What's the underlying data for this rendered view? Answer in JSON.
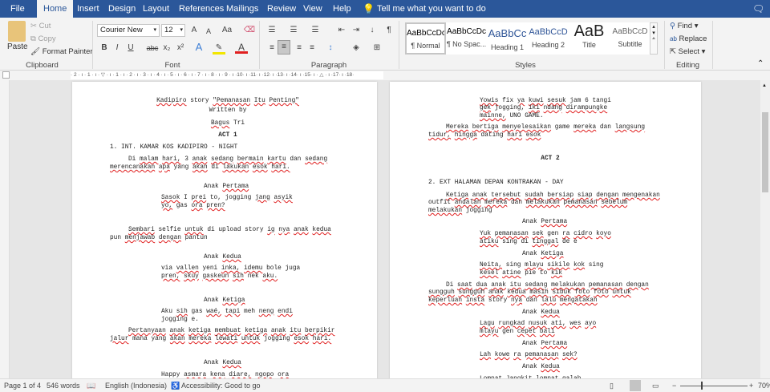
{
  "tabs": [
    "File",
    "Home",
    "Insert",
    "Design",
    "Layout",
    "References",
    "Mailings",
    "Review",
    "View",
    "Help"
  ],
  "tell_me": "Tell me what you want to do",
  "clipboard": {
    "paste": "Paste",
    "cut": "Cut",
    "copy": "Copy",
    "format_painter": "Format Painter",
    "label": "Clipboard"
  },
  "font": {
    "name": "Courier New",
    "size": "12",
    "label": "Font",
    "bold": "B",
    "italic": "I",
    "underline": "U",
    "strike": "abc",
    "sub": "x₂",
    "sup": "x²",
    "case": "Aa",
    "grow": "A",
    "shrink": "A",
    "color_letter": "A"
  },
  "paragraph": {
    "label": "Paragraph"
  },
  "styles": {
    "label": "Styles",
    "items": [
      {
        "preview": "AaBbCcDc",
        "name": "¶ Normal"
      },
      {
        "preview": "AaBbCcDc",
        "name": "¶ No Spac..."
      },
      {
        "preview": "AaBbCc",
        "name": "Heading 1"
      },
      {
        "preview": "AaBbCcD",
        "name": "Heading 2"
      },
      {
        "preview": "AaB",
        "name": "Title"
      },
      {
        "preview": "AaBbCcD",
        "name": "Subtitle"
      }
    ]
  },
  "editing": {
    "find": "Find",
    "replace": "Replace",
    "select": "Select",
    "label": "Editing"
  },
  "ruler": {
    "ticks": "· 2 · ı · 1 · ı · ▽ · ı · 1 · ı · 2 · ı · 3 · ı · 4 · ı · 5 · ı · 6 · ı · 7 · ı · 8 · ı · 9 · ı ·10· ı ·11· ı ·12· ı ·13· ı ·14· ı ·15· ı · △ · ı ·17· ı ·18·"
  },
  "spellcheck_flagged": [
    "Kadipiro",
    "\"Pemanasan",
    "Itu",
    "Penting\"",
    "Bagus",
    "malam",
    "hari,",
    "anak",
    "sedang",
    "bermain",
    "kartu",
    "merencanakan",
    "apa",
    "akan",
    "lakukan",
    "esok",
    "hari.",
    "Pertama",
    "Sasok",
    "prei",
    "jang",
    "asyik",
    "yo,",
    "ora",
    "pren?",
    "Sembari",
    "untuk",
    "ig",
    "nya",
    "kedua",
    "menjawab",
    "dengan",
    "Kedua",
    "vallen",
    "inka,",
    "idemu",
    "pren,",
    "skuy",
    "gaskeun",
    "sih",
    "aku.",
    "Ketiga",
    "waé,",
    "tapi",
    "neng",
    "endi",
    "Pertanyaan",
    "ketiga",
    "membuat",
    "itu",
    "berpikir",
    "jalur",
    "mereka",
    "lewati",
    "asmara",
    "kena",
    "diare,",
    "ngopo",
    "Yowis",
    "ya",
    "kuwi",
    "sesuk",
    "gek",
    "iki",
    "ndang",
    "dirampungke",
    "mainne,",
    "Mereka",
    "bertiga",
    "menyelesaikan",
    "langsung",
    "tidur,",
    "hingga",
    "hari",
    "esok",
    "Ketiga",
    "tersebut",
    "sudah",
    "bersiap",
    "siap",
    "mengenakan",
    "andalan",
    "melakukan",
    "pemanasan",
    "sebelum",
    "Yuk",
    "sek",
    "ra",
    "cidro",
    "koyo",
    "atiku",
    "tinggal",
    "Neita,",
    "mlayu",
    "sikile",
    "kok",
    "kesel",
    "atine",
    "kik",
    "saat",
    "dua",
    "sungguh",
    "masih",
    "sibuk",
    "foto",
    "keperluan",
    "insta",
    "lalu",
    "mengatakan",
    "Lagu",
    "rungkad",
    "nusuk",
    "ati,",
    "wes",
    "ayo",
    "cepet",
    "bali",
    "Lah",
    "kowe",
    "sek?",
    "Jangkit",
    "galah."
  ],
  "page1": [
    {
      "t": "Kadipiro story \"Pemanasan Itu Penting\"",
      "s": "c"
    },
    {
      "t": "Written by",
      "s": "c"
    },
    {
      "t": "Bagus Tri",
      "s": "c"
    },
    {
      "t": "ACT 1",
      "s": "cb"
    },
    {
      "t": "1. INT. KAMAR KOS KADIPIRO - NIGHT",
      "s": "l"
    },
    {
      "t": "Di malam hari, 3 anak sedang bermain kartu dan sedang",
      "s": "i"
    },
    {
      "t": "merencanakan apa yang akan di lakukan esok hari.",
      "s": "l"
    },
    {
      "t": "Anak Pertama",
      "s": "ch"
    },
    {
      "t": "Sasok I prei to, jogging jang asyik",
      "s": "d"
    },
    {
      "t": "yo, gas ora pren?",
      "s": "d"
    },
    {
      "t": "Sembari selfie untuk di upload story ig nya anak kedua",
      "s": "i"
    },
    {
      "t": "pun menjawab dengan pantun",
      "s": "l"
    },
    {
      "t": "Anak Kedua",
      "s": "ch"
    },
    {
      "t": "via vallen yeni inka, idemu bole juga",
      "s": "d"
    },
    {
      "t": "pren, skuy gaskeun sih nek aku.",
      "s": "d"
    },
    {
      "t": "Anak Ketiga",
      "s": "ch"
    },
    {
      "t": "Aku sih gas waé, tapi meh neng endi",
      "s": "d"
    },
    {
      "t": "jogging e.",
      "s": "d"
    },
    {
      "t": "Pertanyaan anak ketiga membuat ketiga anak itu berpikir",
      "s": "i"
    },
    {
      "t": "jalur mana yang akan mereka lewati untuk jogging esok hari.",
      "s": "l"
    },
    {
      "t": "Anak Kedua",
      "s": "ch"
    },
    {
      "t": "Happy asmara kena diare, ngopo ora",
      "s": "d"
    }
  ],
  "page2": [
    {
      "t": "Yowis fix ya kuwi sesuk jam 6 tangi",
      "s": "d"
    },
    {
      "t": "gek jogging, iki ndang dirampungke",
      "s": "d"
    },
    {
      "t": "mainne, UNO GAME.",
      "s": "d"
    },
    {
      "t": "Mereka bertiga menyelesaikan game mereka dan langsung",
      "s": "i"
    },
    {
      "t": "tidur, hingga dating hari esok",
      "s": "l"
    },
    {
      "t": "ACT 2",
      "s": "cb"
    },
    {
      "t": "2. EXT HALAMAN DEPAN KONTRAKAN - DAY",
      "s": "l"
    },
    {
      "t": "Ketiga anak tersebut sudah bersiap siap dengan mengenakan",
      "s": "i"
    },
    {
      "t": "outfit andalan mereka dan melakukan pemanasan sebelum",
      "s": "l"
    },
    {
      "t": "melakukan jogging",
      "s": "l"
    },
    {
      "t": "Anak Pertama",
      "s": "ch"
    },
    {
      "t": "Yuk pemanasan sek gen ra cidro koyo",
      "s": "d"
    },
    {
      "t": "atiku sing di tinggal de e",
      "s": "d"
    },
    {
      "t": "Anak Ketiga",
      "s": "ch"
    },
    {
      "t": "Neita, sing mlayu sikile kok sing",
      "s": "d"
    },
    {
      "t": "kesel atine pie to kik",
      "s": "d"
    },
    {
      "t": "Di saat dua anak itu sedang melakukan pemanasan dengan",
      "s": "i"
    },
    {
      "t": "sungguh sungguh anak kedua masih sibuk foto foto untuk",
      "s": "l"
    },
    {
      "t": "keperluan insta story nya dan lalu mengatakan",
      "s": "l"
    },
    {
      "t": "Anak Kedua",
      "s": "ch"
    },
    {
      "t": "Lagu rungkad nusuk ati, wes ayo",
      "s": "d"
    },
    {
      "t": "mlayu gen cepet bali",
      "s": "d"
    },
    {
      "t": "Anak Pertama",
      "s": "ch"
    },
    {
      "t": "Lah kowe ra pemanasan sek?",
      "s": "d"
    },
    {
      "t": "Anak Kedua",
      "s": "ch"
    },
    {
      "t": "Lompat Jangkit lompat galah.",
      "s": "d"
    }
  ],
  "status": {
    "page": "Page 1 of 4",
    "words": "546 words",
    "language": "English (Indonesia)",
    "accessibility": "Accessibility: Good to go",
    "zoom": "70%"
  },
  "colors": {
    "brand": "#2b579a",
    "spell": "#e02020"
  }
}
